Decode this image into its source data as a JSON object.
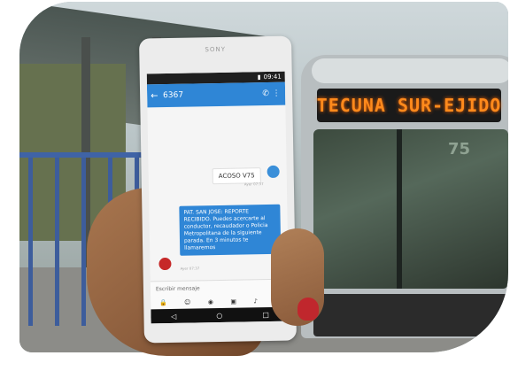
{
  "bus": {
    "destination_sign": "TECUNA SUR-EJIDO",
    "route_number": "75"
  },
  "phone": {
    "brand": "SONY",
    "status_time": "09:41",
    "conversation_title": "6367",
    "messages": [
      {
        "direction": "outgoing",
        "text": "ACOSO V75",
        "time": "Ayer 07:37"
      },
      {
        "direction": "incoming",
        "text": "PAT. SAN JOSE: REPORTE RECIBIDO. Puedes acercarte al conductor, recaudador o Policia Metropolitana de la siguiente parada. En 3 minutos te llamaremos",
        "time": "Ayer 07:37"
      }
    ],
    "compose_placeholder": "Escribir mensaje"
  }
}
